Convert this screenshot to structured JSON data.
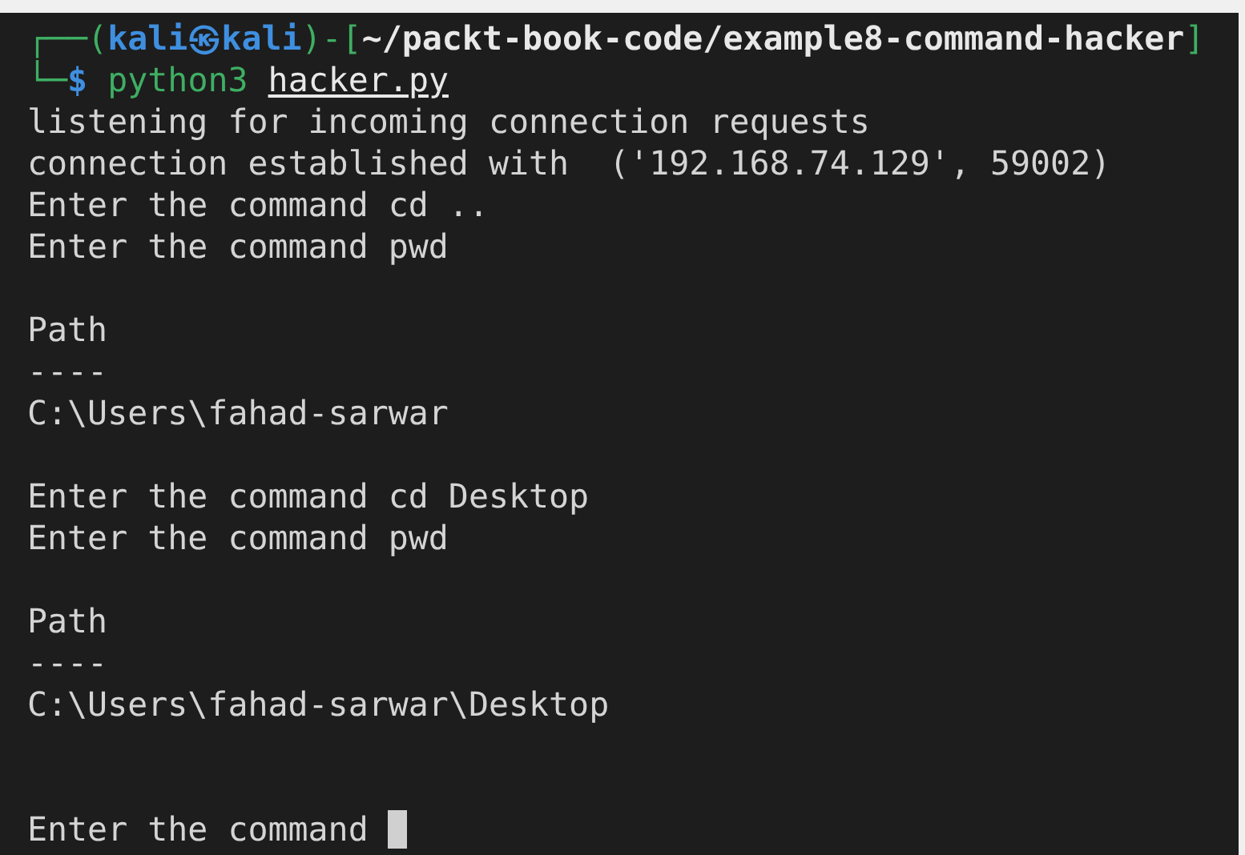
{
  "prompt": {
    "corner_top": "┌──(",
    "user_host": "kali㉿kali",
    "separator": ")-[",
    "path_close": "]",
    "corner_bottom": "└─",
    "path": "~/packt-book-code/example8-command-hacker",
    "symbol": "$",
    "command": "python3",
    "argument": "hacker.py"
  },
  "output": [
    {
      "kind": "text",
      "text": "listening for incoming connection requests"
    },
    {
      "kind": "text",
      "text": "connection established with  ('192.168.74.129', 59002)"
    },
    {
      "kind": "text",
      "text": "Enter the command cd .."
    },
    {
      "kind": "text",
      "text": "Enter the command pwd"
    },
    {
      "kind": "blank"
    },
    {
      "kind": "text",
      "text": "Path"
    },
    {
      "kind": "text",
      "text": "----"
    },
    {
      "kind": "text",
      "text": "C:\\Users\\fahad-sarwar"
    },
    {
      "kind": "blank"
    },
    {
      "kind": "text",
      "text": "Enter the command cd Desktop"
    },
    {
      "kind": "text",
      "text": "Enter the command pwd"
    },
    {
      "kind": "blank"
    },
    {
      "kind": "text",
      "text": "Path"
    },
    {
      "kind": "text",
      "text": "----"
    },
    {
      "kind": "text",
      "text": "C:\\Users\\fahad-sarwar\\Desktop"
    },
    {
      "kind": "blank"
    },
    {
      "kind": "blank"
    },
    {
      "kind": "input",
      "text": "Enter the command "
    }
  ]
}
